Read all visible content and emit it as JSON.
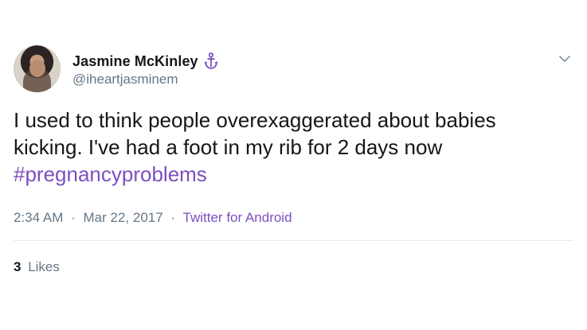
{
  "user": {
    "display_name": "Jasmine McKinley",
    "handle": "@iheartjasminem",
    "avatar_icon": "avatar-photo",
    "badge_icon": "anchor-icon"
  },
  "tweet": {
    "text_line_1": "I used to think people overexaggerated about babies",
    "text_line_2": "kicking. I've had a foot in my rib for 2 days now",
    "hashtag": "#pregnancyproblems"
  },
  "meta": {
    "time": "2:34 AM",
    "date": "Mar 22, 2017",
    "separator": "·",
    "source": "Twitter for Android"
  },
  "stats": {
    "likes_count": "3",
    "likes_label": "Likes"
  },
  "colors": {
    "text": "#14171a",
    "muted": "#657786",
    "accent": "#7b4fc1",
    "divider": "#e6ecf0"
  },
  "icons": {
    "menu": "chevron-down-icon",
    "badge": "anchor-icon"
  }
}
